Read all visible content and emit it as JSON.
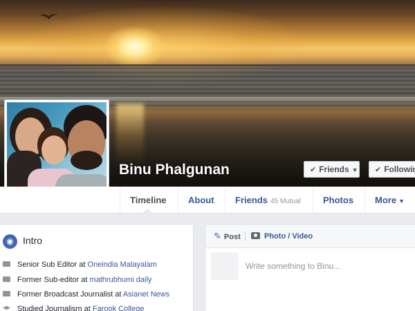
{
  "profile": {
    "name": "Binu Phalgunan"
  },
  "cover_buttons": {
    "friends_label": "Friends",
    "following_label": "Following"
  },
  "nav": {
    "tabs": [
      {
        "label": "Timeline"
      },
      {
        "label": "About"
      },
      {
        "label": "Friends",
        "sub": "45 Mutual"
      },
      {
        "label": "Photos"
      },
      {
        "label": "More"
      }
    ]
  },
  "intro": {
    "title": "Intro",
    "lines": [
      {
        "prefix": "Senior Sub Editor at ",
        "link": "Oneindia Malayalam"
      },
      {
        "prefix": "Former Sub-editor at ",
        "link": "mathrubhumi daily"
      },
      {
        "prefix": "Former Broadcast Journalist at ",
        "link": "Asianet News"
      },
      {
        "prefix": "Studied Journalism at ",
        "link": "Farook College"
      }
    ]
  },
  "composer": {
    "post_label": "Post",
    "photo_label": "Photo / Video",
    "placeholder": "Write something to Binu..."
  },
  "colors": {
    "link": "#365899",
    "accent": "#4267b2"
  }
}
